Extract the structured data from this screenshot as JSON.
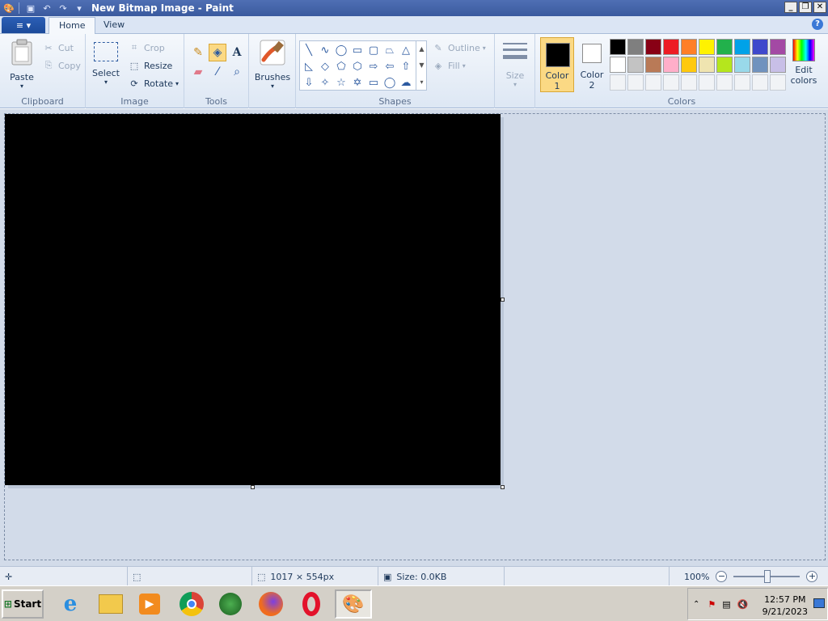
{
  "window": {
    "title": "New Bitmap Image - Paint"
  },
  "tabs": {
    "home": "Home",
    "view": "View"
  },
  "clipboard": {
    "group": "Clipboard",
    "paste": "Paste",
    "cut": "Cut",
    "copy": "Copy"
  },
  "image": {
    "group": "Image",
    "select": "Select",
    "crop": "Crop",
    "resize": "Resize",
    "rotate": "Rotate"
  },
  "tools": {
    "group": "Tools"
  },
  "brushes": {
    "label": "Brushes"
  },
  "shapes": {
    "group": "Shapes",
    "outline": "Outline",
    "fill": "Fill"
  },
  "size": {
    "label": "Size"
  },
  "colors": {
    "group": "Colors",
    "color1_line1": "Color",
    "color1_line2": "1",
    "color2_line1": "Color",
    "color2_line2": "2",
    "edit_line1": "Edit",
    "edit_line2": "colors",
    "color1_value": "#000000",
    "color2_value": "#ffffff",
    "palette_row1": [
      "#000000",
      "#7f7f7f",
      "#880015",
      "#ed1c24",
      "#ff7f27",
      "#fff200",
      "#22b14c",
      "#00a2e8",
      "#3f48cc",
      "#a349a4"
    ],
    "palette_row2": [
      "#ffffff",
      "#c3c3c3",
      "#b97a57",
      "#ffaec9",
      "#ffc90e",
      "#efe4b0",
      "#b5e61d",
      "#99d9ea",
      "#7092be",
      "#c8bfe7"
    ]
  },
  "status": {
    "dimensions": "1017 × 554px",
    "size": "Size: 0.0KB",
    "zoom": "100%"
  },
  "taskbar": {
    "start": "Start",
    "time": "12:57 PM",
    "date": "9/21/2023"
  }
}
